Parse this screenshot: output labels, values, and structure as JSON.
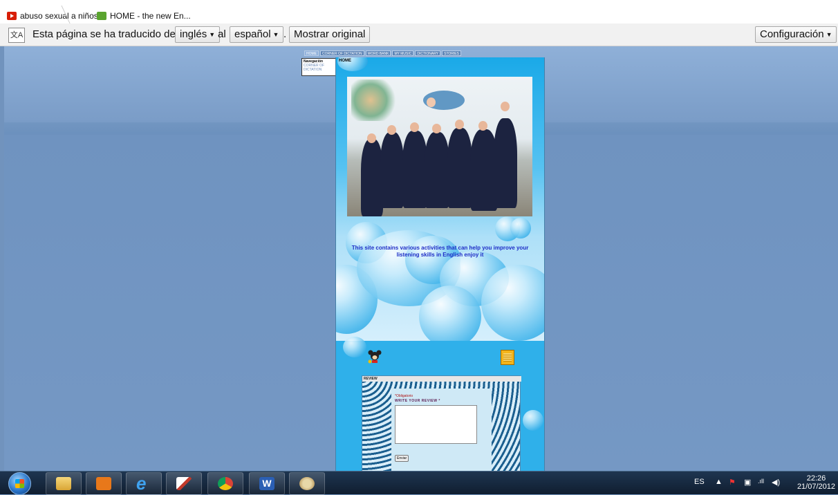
{
  "browser": {
    "tabs": [
      {
        "title": "abuso sexual a niños..."
      },
      {
        "title": "HOME - the new En..."
      }
    ]
  },
  "translate_bar": {
    "text_prefix": "Esta página se ha traducido del",
    "from_language": "inglés",
    "connector": "al",
    "to_language": "español",
    "period": ".",
    "show_original": "Mostrar original",
    "settings": "Configuración"
  },
  "site": {
    "nav": [
      "HOME",
      "CORNER OF DICTATION",
      "WORD BANK",
      "MY MUSIC",
      "DICTIONARY",
      "STORIES"
    ],
    "sidenav": {
      "heading": "Navegación",
      "item": "CORNER OF DICTATION"
    },
    "page_label": "HOME",
    "intro_text": "This site contains various activities that can help you improve your listening skills in English enjoy it",
    "review": {
      "header": "REVIEW",
      "required_note": "*Obligatorio",
      "field_label": "WRITE YOUR REVIEW *",
      "submit": "Enviar"
    }
  },
  "taskbar": {
    "language": "ES",
    "time": "22:26",
    "date": "21/07/2012"
  }
}
